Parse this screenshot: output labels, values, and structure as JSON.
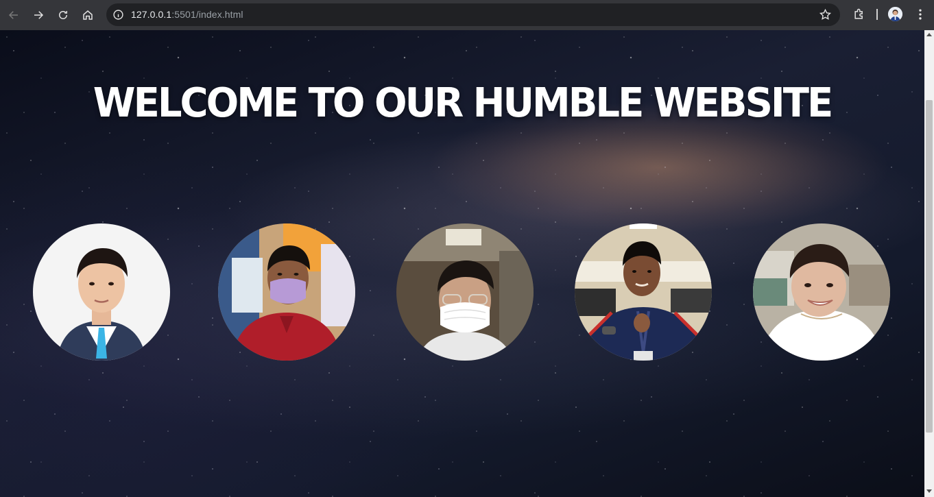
{
  "browser": {
    "url_host": "127.0.0.1",
    "url_rest": ":5501/index.html",
    "icons": {
      "back": "arrow-left-icon",
      "forward": "arrow-right-icon",
      "reload": "reload-icon",
      "home": "home-icon",
      "site_info": "info-icon",
      "bookmark": "star-icon",
      "extensions": "puzzle-icon",
      "profile": "avatar-icon",
      "menu": "kebab-menu-icon"
    }
  },
  "page": {
    "headline": "WELCOME TO OUR HUMBLE WEBSITE",
    "background": "starry-milky-way-image",
    "members": [
      {
        "photo": "member-photo-1",
        "shirt_color": "#ffffff",
        "bg_color": "#f4f4f4",
        "accent": "#2f3c5a"
      },
      {
        "photo": "member-photo-2",
        "shirt_color": "#b01e2a",
        "bg_color": "#c8a47a",
        "accent": "#b79ad6"
      },
      {
        "photo": "member-photo-3",
        "shirt_color": "#e8e8e8",
        "bg_color": "#5a4d3e",
        "accent": "#ffffff"
      },
      {
        "photo": "member-photo-4",
        "shirt_color": "#1d2a55",
        "bg_color": "#d9cdb4",
        "accent": "#c9302c"
      },
      {
        "photo": "member-photo-5",
        "shirt_color": "#ffffff",
        "bg_color": "#b9b2a4",
        "accent": "#e0b9a0"
      }
    ]
  }
}
